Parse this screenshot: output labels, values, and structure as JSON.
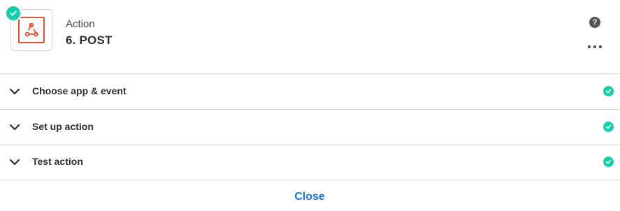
{
  "header": {
    "app_icon": "webhook-icon",
    "status_icon": "check-icon",
    "step_kind": "Action",
    "step_title": "6. POST",
    "help_icon": "help-icon",
    "help_glyph": "?",
    "more_icon": "more-options-icon"
  },
  "sections": [
    {
      "label": "Choose app & event",
      "icon": "chevron-down-icon",
      "status_icon": "check-icon"
    },
    {
      "label": "Set up action",
      "icon": "chevron-down-icon",
      "status_icon": "check-icon"
    },
    {
      "label": "Test action",
      "icon": "chevron-down-icon",
      "status_icon": "check-icon"
    }
  ],
  "footer": {
    "close_label": "Close"
  },
  "colors": {
    "accent": "#13d0ab",
    "webhook_brand": "#ea4f2e",
    "link": "#1a73e8",
    "divider": "#d5d5d5"
  }
}
